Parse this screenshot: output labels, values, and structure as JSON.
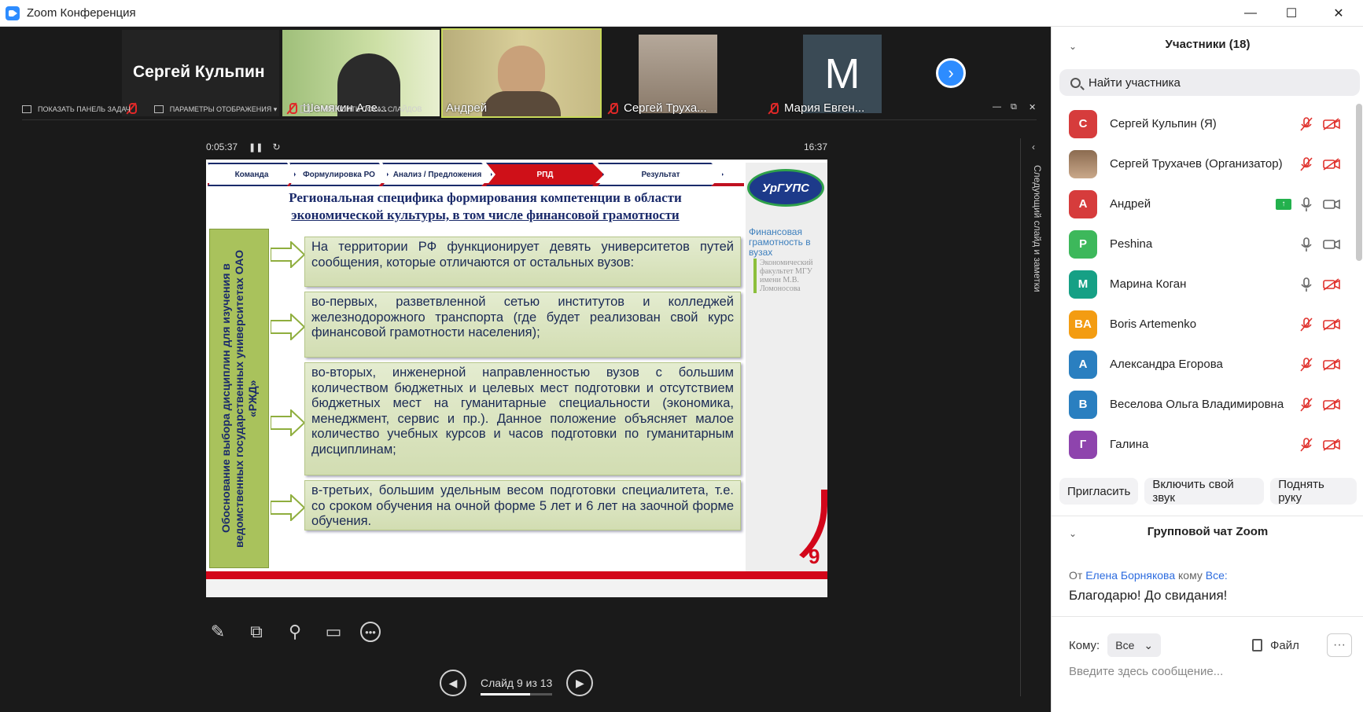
{
  "window": {
    "title": "Zoom Конференция",
    "min": "—",
    "max": "☐",
    "close": "✕"
  },
  "video_strip": {
    "tiles": [
      {
        "name": "Сергей Кульпин",
        "big": "Сергей Кульпин"
      },
      {
        "name": "Шемякин Але..."
      },
      {
        "name": "Андрей"
      },
      {
        "name": "Сергей Труха..."
      },
      {
        "name": "Мария Евген...",
        "initial": "М"
      }
    ]
  },
  "share_toolbar": {
    "show_taskbar": "ПОКАЗАТЬ ПАНЕЛЬ ЗАДАЧ",
    "display_settings": "ПАРАМЕТРЫ ОТОБРАЖЕНИЯ ▾",
    "end_slideshow": "ЗАВЕРШИТЬ ПОКАЗ СЛАЙДОВ"
  },
  "presenter": {
    "elapsed": "0:05:37",
    "clock": "16:37",
    "next_slide_notes": "Следующий слайд и заметки"
  },
  "slide": {
    "steps": [
      "Команда",
      "Формулировка РО",
      "Анализ / Предложения",
      "РПД",
      "Результат"
    ],
    "title_line1": "Региональная специфика формирования компетенции в области",
    "title_line2": "экономической культуры, в том числе финансовой грамотности",
    "vertical": "Обоснование выбора дисциплин для изучения в ведомственных государственных университетах ОАО «РЖД»",
    "boxes": [
      "На территории РФ функционирует девять университетов путей сообщения, которые отличаются от остальных вузов:",
      "во-первых, разветвленной сетью институтов и колледжей железнодорожного транспорта (где будет реализован свой курс финансовой грамотности населения);",
      "во-вторых, инженерной направленностью вузов с большим количеством бюджетных и целевых мест подготовки и отсутствием бюджетных мест на гуманитарные специальности (экономика, менеджмент, сервис и пр.). Данное положение объясняет малое количество учебных курсов и часов подготовки по гуманитарным дисциплинам;",
      "в-третьих, большим удельным весом подготовки специалитета, т.е. со сроком обучения на очной форме 5 лет и 6 лет на заочной форме обучения."
    ],
    "logo": "УрГУПС",
    "fin_logo": "Финансовая грамотность в вузах",
    "msu_logo": "Экономический факультет МГУ имени М.В. Ломоносова",
    "number": "9"
  },
  "slide_nav": {
    "label": "Слайд 9 из 13",
    "progress": 0.69
  },
  "panel": {
    "participants_title": "Участники (18)",
    "search_placeholder": "Найти участника",
    "participants": [
      {
        "initial": "С",
        "name": "Сергей Кульпин (Я)",
        "color": "#d63c3c",
        "mic": "muted",
        "cam": "off"
      },
      {
        "initial": "",
        "name": "Сергей Трухачев (Организатор)",
        "color": "photo",
        "mic": "muted",
        "cam": "off"
      },
      {
        "initial": "А",
        "name": "Андрей",
        "color": "#d63c3c",
        "mic": "on",
        "cam": "on",
        "sharing": true
      },
      {
        "initial": "P",
        "name": "Peshina",
        "color": "#3db85b",
        "mic": "on",
        "cam": "on"
      },
      {
        "initial": "М",
        "name": "Марина Коган",
        "color": "#16a085",
        "mic": "on",
        "cam": "off"
      },
      {
        "initial": "BA",
        "name": "Boris Artemenko",
        "color": "#f39c12",
        "mic": "muted",
        "cam": "off"
      },
      {
        "initial": "А",
        "name": "Александра Егорова",
        "color": "#2a7fc0",
        "mic": "muted",
        "cam": "off"
      },
      {
        "initial": "В",
        "name": "Веселова Ольга Владимировна",
        "color": "#2a7fc0",
        "mic": "muted",
        "cam": "off"
      },
      {
        "initial": "Г",
        "name": "Галина",
        "color": "#8e44ad",
        "mic": "muted",
        "cam": "off"
      }
    ],
    "buttons": [
      "Пригласить",
      "Включить свой звук",
      "Поднять руку"
    ],
    "chat_title": "Групповой чат Zoom",
    "chat": {
      "from_prefix": "От",
      "from": "Елена Борнякова",
      "to_prefix": "кому",
      "to": "Все:",
      "message": "Благодарю! До свидания!"
    },
    "to_label": "Кому:",
    "to_value": "Все",
    "file_label": "Файл",
    "input_placeholder": "Введите здесь сообщение..."
  },
  "colors": {
    "accent": "#2d8cff",
    "red": "#d3061a",
    "green_box": "#a9c25c"
  }
}
